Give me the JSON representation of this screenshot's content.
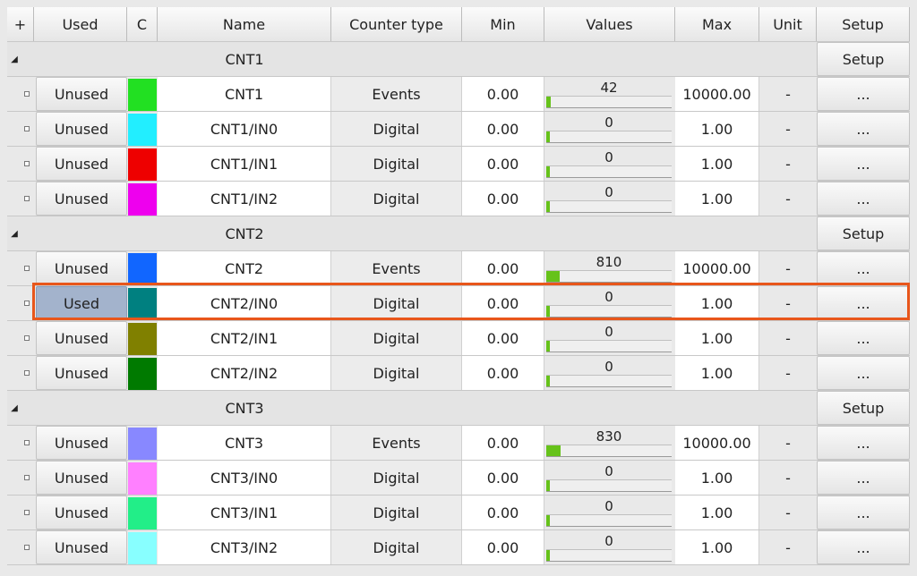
{
  "header": {
    "plus": "+",
    "used": "Used",
    "c": "C",
    "name": "Name",
    "counter_type": "Counter type",
    "min": "Min",
    "values": "Values",
    "max": "Max",
    "unit": "Unit",
    "setup": "Setup"
  },
  "groups": [
    {
      "name": "CNT1",
      "setup": "Setup",
      "rows": [
        {
          "used": "Unused",
          "color": "#22e022",
          "name": "CNT1",
          "type": "Events",
          "min": "0.00",
          "value": "42",
          "fraction": 0.0042,
          "max": "10000.00",
          "unit": "-",
          "setup": "..."
        },
        {
          "used": "Unused",
          "color": "#22eeff",
          "name": "CNT1/IN0",
          "type": "Digital",
          "min": "0.00",
          "value": "0",
          "fraction": 0,
          "max": "1.00",
          "unit": "-",
          "setup": "..."
        },
        {
          "used": "Unused",
          "color": "#ee0000",
          "name": "CNT1/IN1",
          "type": "Digital",
          "min": "0.00",
          "value": "0",
          "fraction": 0,
          "max": "1.00",
          "unit": "-",
          "setup": "..."
        },
        {
          "used": "Unused",
          "color": "#ee00ee",
          "name": "CNT1/IN2",
          "type": "Digital",
          "min": "0.00",
          "value": "0",
          "fraction": 0,
          "max": "1.00",
          "unit": "-",
          "setup": "..."
        }
      ]
    },
    {
      "name": "CNT2",
      "setup": "Setup",
      "rows": [
        {
          "used": "Unused",
          "color": "#1166ff",
          "name": "CNT2",
          "type": "Events",
          "min": "0.00",
          "value": "810",
          "fraction": 0.081,
          "max": "10000.00",
          "unit": "-",
          "setup": "..."
        },
        {
          "used": "Used",
          "color": "#008080",
          "name": "CNT2/IN0",
          "type": "Digital",
          "min": "0.00",
          "value": "0",
          "fraction": 0,
          "max": "1.00",
          "unit": "-",
          "setup": "...",
          "selected": true
        },
        {
          "used": "Unused",
          "color": "#808000",
          "name": "CNT2/IN1",
          "type": "Digital",
          "min": "0.00",
          "value": "0",
          "fraction": 0,
          "max": "1.00",
          "unit": "-",
          "setup": "..."
        },
        {
          "used": "Unused",
          "color": "#007a00",
          "name": "CNT2/IN2",
          "type": "Digital",
          "min": "0.00",
          "value": "0",
          "fraction": 0,
          "max": "1.00",
          "unit": "-",
          "setup": "..."
        }
      ]
    },
    {
      "name": "CNT3",
      "setup": "Setup",
      "rows": [
        {
          "used": "Unused",
          "color": "#8888ff",
          "name": "CNT3",
          "type": "Events",
          "min": "0.00",
          "value": "830",
          "fraction": 0.083,
          "max": "10000.00",
          "unit": "-",
          "setup": "..."
        },
        {
          "used": "Unused",
          "color": "#ff80ff",
          "name": "CNT3/IN0",
          "type": "Digital",
          "min": "0.00",
          "value": "0",
          "fraction": 0,
          "max": "1.00",
          "unit": "-",
          "setup": "..."
        },
        {
          "used": "Unused",
          "color": "#22ee88",
          "name": "CNT3/IN1",
          "type": "Digital",
          "min": "0.00",
          "value": "0",
          "fraction": 0,
          "max": "1.00",
          "unit": "-",
          "setup": "..."
        },
        {
          "used": "Unused",
          "color": "#88ffff",
          "name": "CNT3/IN2",
          "type": "Digital",
          "min": "0.00",
          "value": "0",
          "fraction": 0,
          "max": "1.00",
          "unit": "-",
          "setup": "..."
        }
      ]
    }
  ]
}
